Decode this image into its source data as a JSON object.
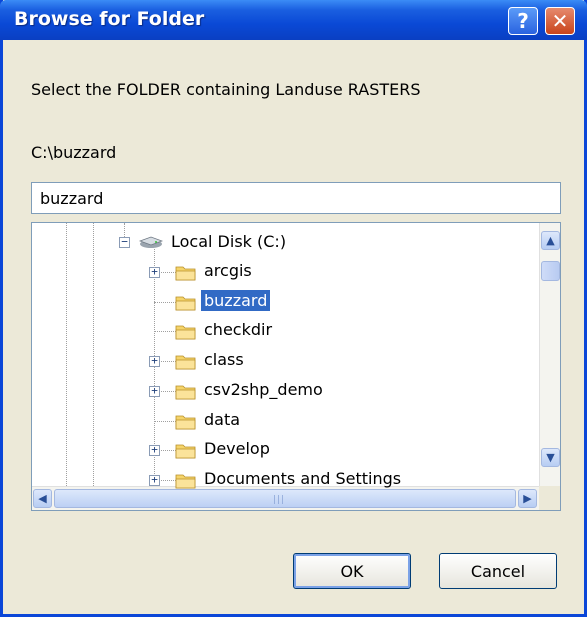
{
  "window": {
    "title": "Browse for Folder",
    "help_label": "?",
    "close_label": "✕"
  },
  "dialog": {
    "prompt": "Select the FOLDER containing Landuse RASTERS",
    "current_path": "C:\\buzzard",
    "folder_value": "buzzard"
  },
  "tree": {
    "root": {
      "label": "Local Disk (C:)",
      "icon": "hard-drive-icon",
      "expanded": true
    },
    "items": [
      {
        "label": "arcgis",
        "expandable": true,
        "selected": false
      },
      {
        "label": "buzzard",
        "expandable": false,
        "selected": true
      },
      {
        "label": "checkdir",
        "expandable": false,
        "selected": false
      },
      {
        "label": "class",
        "expandable": true,
        "selected": false
      },
      {
        "label": "csv2shp_demo",
        "expandable": true,
        "selected": false
      },
      {
        "label": "data",
        "expandable": false,
        "selected": false
      },
      {
        "label": "Develop",
        "expandable": true,
        "selected": false
      },
      {
        "label": "Documents and Settings",
        "expandable": true,
        "selected": false
      }
    ]
  },
  "buttons": {
    "ok": "OK",
    "cancel": "Cancel"
  },
  "colors": {
    "title_bar": "#0a49d6",
    "selection": "#316ac5",
    "dialog_bg": "#ece9d8"
  }
}
